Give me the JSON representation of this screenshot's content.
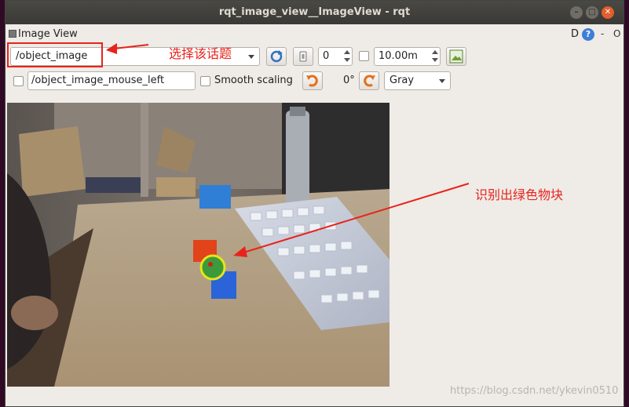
{
  "window": {
    "title": "rqt_image_view__ImageView - rqt"
  },
  "dock": {
    "title": "Image View",
    "d_label": "D",
    "help_label": "?",
    "close_label": "-",
    "float_label": "O"
  },
  "toolbar": {
    "topic": "/object_image",
    "spin_value": "0",
    "rate": "10.00m",
    "mouse_topic": "/object_image_mouse_left",
    "smooth_label": "Smooth scaling",
    "rotation": "0°",
    "color_scheme": "Gray"
  },
  "annotations": {
    "select_topic": "选择该话题",
    "detected": "识别出绿色物块"
  },
  "watermark": "https://blog.csdn.net/ykevin0510",
  "colors": {
    "annotation": "#e8231b",
    "accent": "#3d7fd6",
    "title_bar": "#3f3e3a"
  },
  "icons": [
    "refresh-icon",
    "pause-icon",
    "save-icon",
    "rotate-left-icon",
    "rotate-right-icon",
    "help-icon"
  ]
}
